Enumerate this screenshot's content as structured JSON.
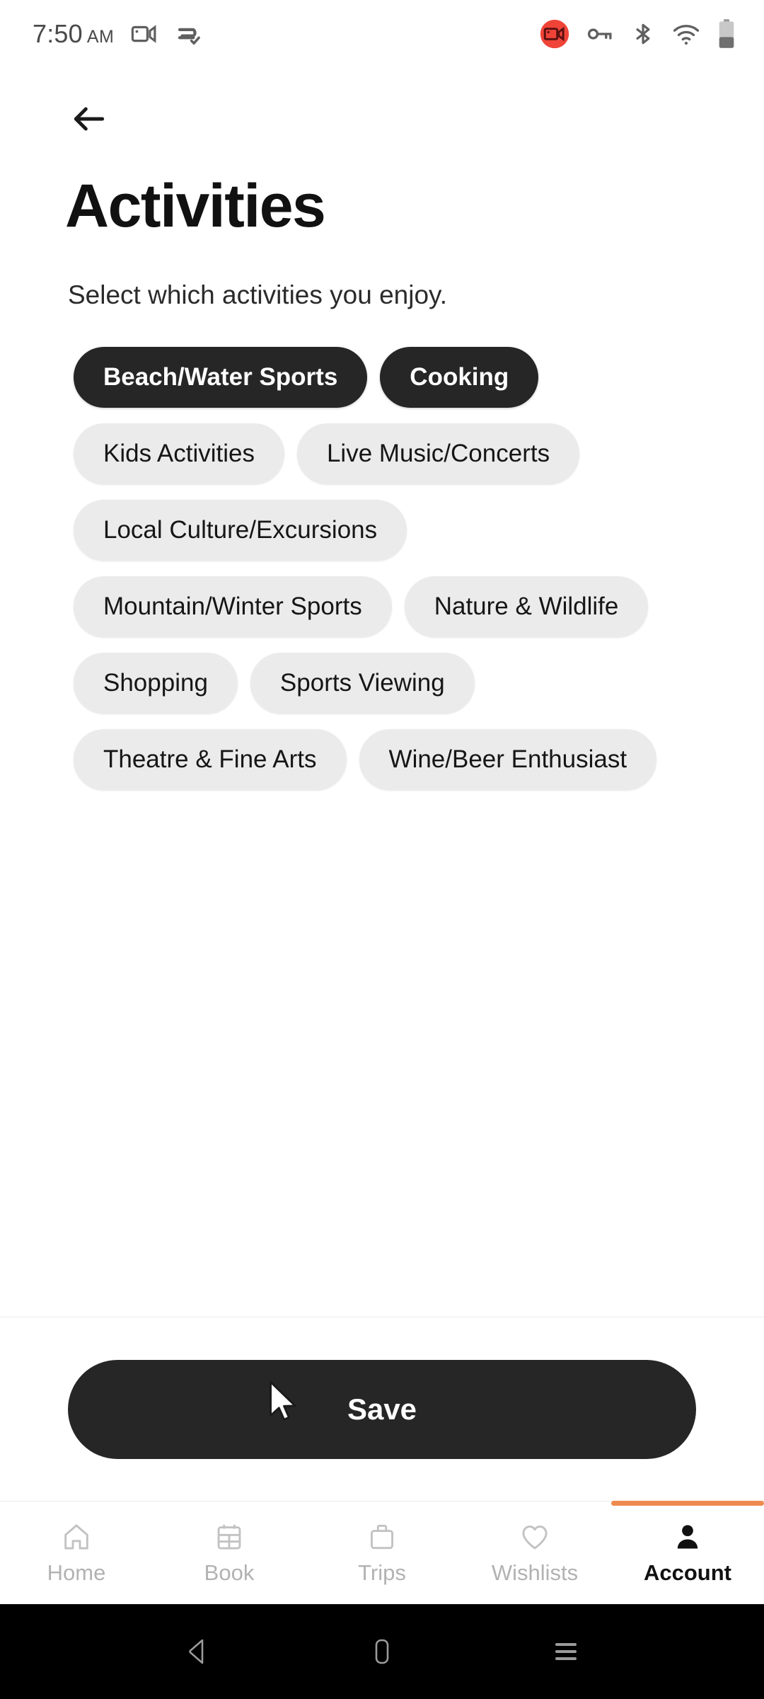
{
  "status_bar": {
    "time": "7:50",
    "ampm": "AM",
    "left_icons": [
      "screen-record-icon",
      "data-saver-icon"
    ],
    "right_icons": [
      "screen-recording-active-icon",
      "vpn-key-icon",
      "bluetooth-icon",
      "wifi-icon",
      "battery-icon"
    ],
    "recording_badge_color": "#F04438"
  },
  "header": {
    "back_label": "Back",
    "title": "Activities",
    "subtitle": "Select which activities you enjoy."
  },
  "chips": [
    {
      "label": "Beach/Water Sports",
      "selected": true
    },
    {
      "label": "Cooking",
      "selected": true
    },
    {
      "label": "Kids Activities",
      "selected": false
    },
    {
      "label": "Live Music/Concerts",
      "selected": false
    },
    {
      "label": "Local Culture/Excursions",
      "selected": false
    },
    {
      "label": "Mountain/Winter Sports",
      "selected": false
    },
    {
      "label": "Nature & Wildlife",
      "selected": false
    },
    {
      "label": "Shopping",
      "selected": false
    },
    {
      "label": "Sports Viewing",
      "selected": false
    },
    {
      "label": "Theatre & Fine Arts",
      "selected": false
    },
    {
      "label": "Wine/Beer Enthusiast",
      "selected": false
    }
  ],
  "footer": {
    "save_label": "Save",
    "cursor_present": true
  },
  "bottom_nav": {
    "active_index": 4,
    "accent_color": "#EE8A4E",
    "items": [
      {
        "label": "Home",
        "icon": "home-icon"
      },
      {
        "label": "Book",
        "icon": "calendar-icon"
      },
      {
        "label": "Trips",
        "icon": "suitcase-icon"
      },
      {
        "label": "Wishlists",
        "icon": "heart-icon"
      },
      {
        "label": "Account",
        "icon": "person-icon"
      }
    ]
  },
  "android_nav": {
    "buttons": [
      {
        "name": "back",
        "icon": "triangle-back-icon"
      },
      {
        "name": "home",
        "icon": "rounded-rect-home-icon"
      },
      {
        "name": "recents",
        "icon": "menu-lines-icon"
      }
    ]
  },
  "colors": {
    "chip_selected_bg": "#262626",
    "chip_bg": "#EBEBEB",
    "accent_orange": "#EE8A4E",
    "text_primary": "#111111"
  }
}
